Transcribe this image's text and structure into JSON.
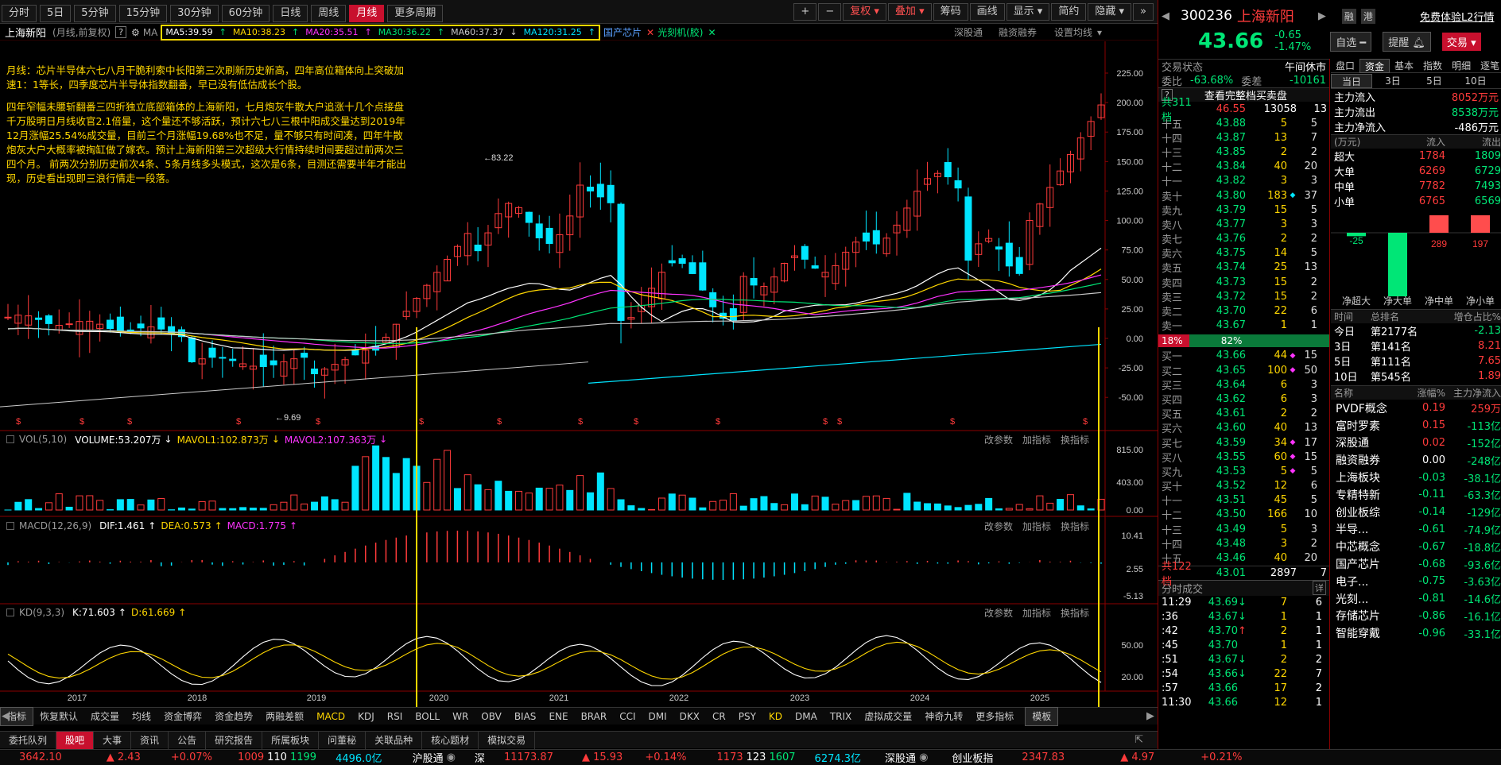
{
  "tabs_top": [
    "分时",
    "5日",
    "5分钟",
    "15分钟",
    "30分钟",
    "60分钟",
    "日线",
    "周线",
    "月线",
    "更多周期"
  ],
  "toolbar_right": {
    "plus": "+",
    "minus": "−",
    "fq": "复权",
    "overlay": "叠加",
    "chip": "筹码",
    "draw": "画线",
    "display": "显示",
    "brief": "简约",
    "hide": "隐藏",
    "expand": "»"
  },
  "stock_bar": {
    "name": "上海新阳",
    "mode": "(月线,前复权)",
    "help": "?",
    "ma_label": "MA",
    "ma5": "MA5:39.59",
    "ma10": "MA10:38.23",
    "ma20": "MA20:35.51",
    "ma30": "MA30:36.22",
    "ma60": "MA60:37.37",
    "ma120": "MA120:31.25",
    "concept1": "国产芯片",
    "concept2": "光刻机(胶)",
    "right1": "深股通",
    "right2": "融资融券",
    "right3": "设置均线"
  },
  "colors": {
    "ma5": "#ffffff",
    "ma10": "#ffd700",
    "ma20": "#ff33ff",
    "ma30": "#00e676",
    "ma60": "#c8c8c8",
    "ma120": "#00e5ff",
    "up": "#ff3b3b",
    "down": "#00e5ff",
    "border": "#8b0000",
    "accent": "#c8102e"
  },
  "note": {
    "p1": "月线：芯片半导体六七八月干脆利索中长阳第三次刷新历史新高，四年高位箱体向上突破加速1：1等长，四季度芯片半导体指数翻番，早已没有低估成长个股。",
    "p2": "四年窄幅未腰斩翻番三四折独立底部箱体的上海新阳，七月炮灰牛散大户追涨十几个点接盘千万股明日月线收官2.1倍量，这个量还不够活跃，预计六七八三根中阳成交量达到2019年12月涨幅25.54%成交量，目前三个月涨幅19.68%也不足，量不够只有时间凑，四年牛散炮灰大户大概率被掏缸做了嫁衣。预计上海新阳第三次超级大行情持续时间要超过前两次三四个月。 前两次分别历史前次4条、5条月线多头模式，这次是6条，目测还需要半年才能出现，历史看出现即三浪行情走一段落。"
  },
  "annotations": {
    "high": "83.22",
    "low": "9.69"
  },
  "price_axis": [
    "225.00",
    "200.00",
    "175.00",
    "150.00",
    "125.00",
    "100.00",
    "75.00",
    "50.00",
    "25.00",
    "0.00",
    "-25.00",
    "-50.00"
  ],
  "years": [
    "2017",
    "2018",
    "2019",
    "2020",
    "2021",
    "2022",
    "2023",
    "2024",
    "2025"
  ],
  "vol_panel": {
    "title": "VOL(5,10)",
    "volume": "VOLUME:53.207万",
    "mavol1": "MAVOL1:102.873万",
    "mavol2": "MAVOL2:107.363万",
    "axis": [
      "815.00",
      "403.00",
      "0.00"
    ],
    "btns": [
      "改参数",
      "加指标",
      "换指标"
    ]
  },
  "macd_panel": {
    "title": "MACD(12,26,9)",
    "dif": "DIF:1.461",
    "dea": "DEA:0.573",
    "macd": "MACD:1.775",
    "axis": [
      "10.41",
      "2.55",
      "-5.13"
    ]
  },
  "kd_panel": {
    "title": "KD(9,3,3)",
    "k": "K:71.603",
    "d": "D:61.669",
    "axis": [
      "50.00",
      "20.00"
    ]
  },
  "indicator_tabs": [
    "指标",
    "恢复默认",
    "成交量",
    "均线",
    "资金博弈",
    "资金趋势",
    "两融差额",
    "MACD",
    "KDJ",
    "RSI",
    "BOLL",
    "WR",
    "OBV",
    "BIAS",
    "ENE",
    "BRAR",
    "CCI",
    "DMI",
    "DKX",
    "CR",
    "PSY",
    "KD",
    "DMA",
    "TRIX",
    "虚拟成交量",
    "神奇九转",
    "更多指标",
    "模板"
  ],
  "bottom_tabs": [
    "委托队列",
    "股吧",
    "大事",
    "资讯",
    "公告",
    "研究报告",
    "所属板块",
    "问董秘",
    "关联品种",
    "核心题材",
    "模拟交易"
  ],
  "status": {
    "sh_idx": "3642.10",
    "sh_chg": "▲ 2.43",
    "sh_pct": "+0.07%",
    "sh_up": "1009",
    "sh_flat": "110",
    "sh_down": "1199",
    "sh_amt": "4496.0亿",
    "hgt": "沪股通",
    "sz": "深",
    "sz_idx": "11173.87",
    "sz_chg": "▲ 15.93",
    "sz_pct": "+0.14%",
    "sz_up": "1173",
    "sz_flat": "123",
    "sz_down": "1607",
    "sz_amt": "6274.3亿",
    "sgt": "深股通",
    "cyb": "创业板指",
    "cyb_idx": "2347.83",
    "cyb_chg": "▲ 4.97",
    "cyb_pct": "+0.21%"
  },
  "quote": {
    "code": "300236",
    "name": "上海新阳",
    "price": "43.66",
    "chg": "-0.65",
    "pct": "-1.47%",
    "tag1": "融",
    "tag2": "港",
    "free": "免费体验L2行情",
    "watch": "自选",
    "remind": "提醒",
    "trade": "交易"
  },
  "trade_state": {
    "label": "交易状态",
    "value": "午间休市",
    "wb_label": "委比",
    "wb_val": "-63.68%",
    "wc_label": "委差",
    "wc_val": "-10161"
  },
  "ob_header": {
    "q": "?",
    "full": "查看完整档买卖盘",
    "total_label": "共311档",
    "total_price": "46.55",
    "total_vol": "13058",
    "total_cnt": "13"
  },
  "asks": [
    [
      "十五",
      "43.88",
      "5",
      "",
      "5"
    ],
    [
      "十四",
      "43.87",
      "13",
      "",
      "7"
    ],
    [
      "十三",
      "43.85",
      "2",
      "",
      "2"
    ],
    [
      "十二",
      "43.84",
      "40",
      "",
      "20"
    ],
    [
      "十一",
      "43.82",
      "3",
      "",
      "3"
    ],
    [
      "卖十",
      "43.80",
      "183",
      "◆",
      "37"
    ],
    [
      "卖九",
      "43.79",
      "15",
      "",
      "5"
    ],
    [
      "卖八",
      "43.77",
      "3",
      "",
      "3"
    ],
    [
      "卖七",
      "43.76",
      "2",
      "",
      "2"
    ],
    [
      "卖六",
      "43.75",
      "14",
      "",
      "5"
    ],
    [
      "卖五",
      "43.74",
      "25",
      "",
      "13"
    ],
    [
      "卖四",
      "43.73",
      "15",
      "",
      "2"
    ],
    [
      "卖三",
      "43.72",
      "15",
      "",
      "2"
    ],
    [
      "卖二",
      "43.70",
      "22",
      "",
      "6"
    ],
    [
      "卖一",
      "43.67",
      "1",
      "",
      "1"
    ]
  ],
  "ratio": {
    "buy": "18%",
    "sell": "82%"
  },
  "bids": [
    [
      "买一",
      "43.66",
      "44",
      "◆",
      "15"
    ],
    [
      "买二",
      "43.65",
      "100",
      "◆",
      "50"
    ],
    [
      "买三",
      "43.64",
      "6",
      "",
      "3"
    ],
    [
      "买四",
      "43.62",
      "6",
      "",
      "3"
    ],
    [
      "买五",
      "43.61",
      "2",
      "",
      "2"
    ],
    [
      "买六",
      "43.60",
      "40",
      "",
      "13"
    ],
    [
      "买七",
      "43.59",
      "34",
      "◆",
      "17"
    ],
    [
      "买八",
      "43.55",
      "60",
      "◆",
      "15"
    ],
    [
      "买九",
      "43.53",
      "5",
      "◆",
      "5"
    ],
    [
      "买十",
      "43.52",
      "12",
      "",
      "6"
    ],
    [
      "十一",
      "43.51",
      "45",
      "",
      "5"
    ],
    [
      "十二",
      "43.50",
      "166",
      "",
      "10"
    ],
    [
      "十三",
      "43.49",
      "5",
      "",
      "3"
    ],
    [
      "十四",
      "43.48",
      "3",
      "",
      "2"
    ],
    [
      "十五",
      "43.46",
      "40",
      "",
      "20"
    ]
  ],
  "bid_total": {
    "label": "共122档",
    "price": "43.01",
    "vol": "2897",
    "cnt": "7"
  },
  "ticks_header": {
    "title": "分时成交",
    "btn": "详"
  },
  "ticks": [
    [
      "11:29",
      "43.69",
      "↓",
      "7",
      "6"
    ],
    [
      ":36",
      "43.67",
      "↓",
      "1",
      "1"
    ],
    [
      ":42",
      "43.70",
      "↑",
      "2",
      "1"
    ],
    [
      ":45",
      "43.70",
      "",
      "1",
      "1"
    ],
    [
      ":51",
      "43.67",
      "↓",
      "2",
      "2"
    ],
    [
      ":54",
      "43.66",
      "↓",
      "22",
      "7"
    ],
    [
      ":57",
      "43.66",
      "",
      "17",
      "2"
    ],
    [
      "11:30",
      "43.66",
      "",
      "12",
      "1"
    ]
  ],
  "fund_tabs": [
    "盘口",
    "资金",
    "基本",
    "指数",
    "明细",
    "逐笔"
  ],
  "period_tabs": [
    "当日",
    "3日",
    "5日",
    "10日"
  ],
  "fund_flow": [
    [
      "主力流入",
      "8052万元"
    ],
    [
      "主力流出",
      "8538万元"
    ],
    [
      "主力净流入",
      "-486万元"
    ]
  ],
  "fund_table_header": [
    "(万元)",
    "流入",
    "流出"
  ],
  "fund_table": [
    [
      "超大",
      "1784",
      "1809"
    ],
    [
      "大单",
      "6269",
      "6729"
    ],
    [
      "中单",
      "7782",
      "7493"
    ],
    [
      "小单",
      "6765",
      "6569"
    ]
  ],
  "net_bars": {
    "values": [
      -25,
      -461,
      289,
      197
    ],
    "labels": [
      "净超大",
      "净大单",
      "净中单",
      "净小单"
    ]
  },
  "rank_header": [
    "时间",
    "总排名",
    "增仓占比%"
  ],
  "rank": [
    [
      "今日",
      "第2177名",
      "-2.13"
    ],
    [
      "3日",
      "第141名",
      "8.21"
    ],
    [
      "5日",
      "第111名",
      "7.65"
    ],
    [
      "10日",
      "第545名",
      "1.89"
    ]
  ],
  "blocks_header": [
    "名称",
    "涨幅%",
    "主力净流入"
  ],
  "blocks": [
    [
      "PVDF概念",
      "0.19",
      "259万"
    ],
    [
      "富时罗素",
      "0.15",
      "-113亿"
    ],
    [
      "深股通",
      "0.02",
      "-152亿"
    ],
    [
      "融资融券",
      "0.00",
      "-248亿"
    ],
    [
      "上海板块",
      "-0.03",
      "-38.1亿"
    ],
    [
      "专精特新",
      "-0.11",
      "-63.3亿"
    ],
    [
      "创业板综",
      "-0.14",
      "-129亿"
    ],
    [
      "半导...",
      "-0.61",
      "-74.9亿"
    ],
    [
      "中芯概念",
      "-0.67",
      "-18.8亿"
    ],
    [
      "国产芯片",
      "-0.68",
      "-93.6亿"
    ],
    [
      "电子...",
      "-0.75",
      "-3.63亿"
    ],
    [
      "光刻...",
      "-0.81",
      "-14.6亿"
    ],
    [
      "存储芯片",
      "-0.86",
      "-16.1亿"
    ],
    [
      "智能穿戴",
      "-0.96",
      "-33.1亿"
    ]
  ]
}
